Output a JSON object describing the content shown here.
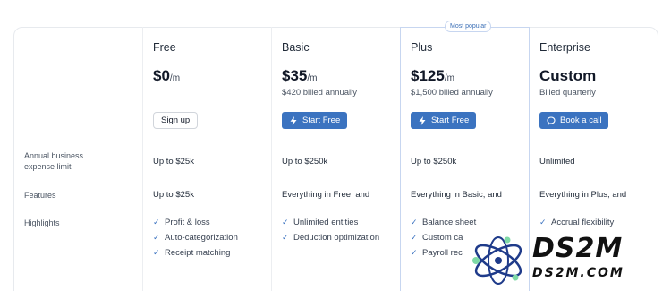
{
  "badge": {
    "most_popular": "Most popular"
  },
  "plans": [
    {
      "name": "Free",
      "price": "$0",
      "per": "/m",
      "billing": "",
      "button": "Sign up"
    },
    {
      "name": "Basic",
      "price": "$35",
      "per": "/m",
      "billing": "$420 billed annually",
      "button": "Start Free"
    },
    {
      "name": "Plus",
      "price": "$125",
      "per": "/m",
      "billing": "$1,500 billed annually",
      "button": "Start Free"
    },
    {
      "name": "Enterprise",
      "price": "Custom",
      "per": "",
      "billing": "Billed quarterly",
      "button": "Book a call"
    }
  ],
  "rows": {
    "expense_limit": {
      "label_line1": "Annual business",
      "label_line2": "expense limit",
      "values": [
        "Up to $25k",
        "Up to $250k",
        "Up to $250k",
        "Unlimited"
      ]
    },
    "features": {
      "label": "Features",
      "values": [
        "Up to $25k",
        "Everything in Free, and",
        "Everything in Basic, and",
        "Everything in Plus, and"
      ]
    },
    "highlights": {
      "label": "Highlights",
      "free": [
        "Profit & loss",
        "Auto-categorization",
        "Receipt matching"
      ],
      "basic": [
        "Unlimited entities",
        "Deduction optimization"
      ],
      "plus": [
        "Balance sheet",
        "Custom ca",
        "Payroll rec"
      ],
      "enterprise": [
        "Accrual flexibility"
      ]
    }
  },
  "watermark": {
    "big": "DS2M",
    "small": "DS2M.COM"
  },
  "colors": {
    "accent": "#3b73c0",
    "border": "#e7eaee",
    "highlight_border": "#c7d6f0"
  }
}
